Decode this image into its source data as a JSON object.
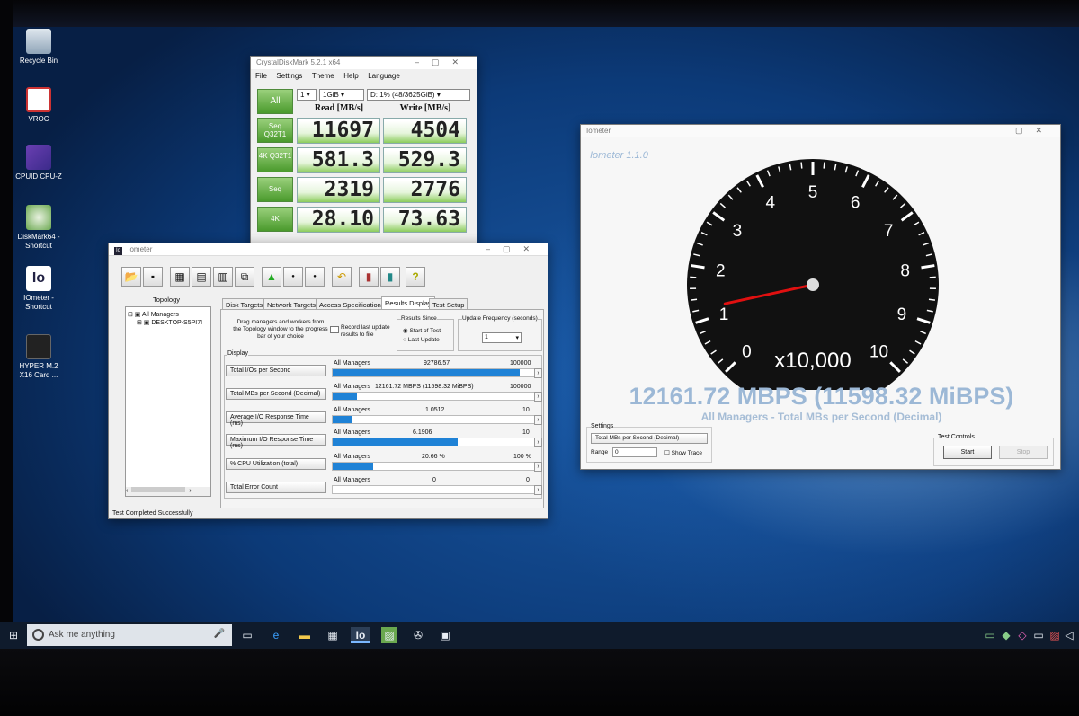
{
  "desktop": {
    "icons": [
      {
        "label": "Recycle Bin"
      },
      {
        "label": "VROC"
      },
      {
        "label": "CPUID CPU-Z"
      },
      {
        "label": "DiskMark64 - Shortcut"
      },
      {
        "label": "IOmeter - Shortcut"
      },
      {
        "label": "HYPER M.2 X16 Card ..."
      }
    ]
  },
  "cdm": {
    "title": "CrystalDiskMark 5.2.1 x64",
    "menu": [
      "File",
      "Settings",
      "Theme",
      "Help",
      "Language"
    ],
    "all_label": "All",
    "count": "1",
    "size": "1GiB",
    "drive": "D: 1% (48/3625GiB)",
    "read_header": "Read [MB/s]",
    "write_header": "Write [MB/s]",
    "rows": [
      {
        "label": "Seq Q32T1",
        "read": "11697",
        "write": "4504"
      },
      {
        "label": "4K Q32T1",
        "read": "581.3",
        "write": "529.3"
      },
      {
        "label": "Seq",
        "read": "2319",
        "write": "2776"
      },
      {
        "label": "4K",
        "read": "28.10",
        "write": "73.63"
      }
    ]
  },
  "iometer": {
    "title": "Iometer",
    "topology_header": "Topology",
    "tree": [
      "All Managers",
      "DESKTOP-S5PI7I"
    ],
    "tabs": [
      "Disk Targets",
      "Network Targets",
      "Access Specifications",
      "Results Display",
      "Test Setup"
    ],
    "instructions": "Drag managers and workers from the Topology window to the progress bar of your choice",
    "record_label": "Record last update results to file",
    "results_since_title": "Results Since",
    "results_since": [
      "Start of Test",
      "Last Update"
    ],
    "update_freq_title": "Update Frequency (seconds)",
    "update_freq_value": "1",
    "display_title": "Display",
    "rows": [
      {
        "label": "Total I/Os per Second",
        "manager": "All Managers",
        "value": "92786.57",
        "max": "100000",
        "fraction": 0.93
      },
      {
        "label": "Total MBs per Second (Decimal)",
        "manager": "All Managers",
        "value": "12161.72 MBPS (11598.32 MiBPS)",
        "max": "100000",
        "fraction": 0.12
      },
      {
        "label": "Average I/O Response Time (ms)",
        "manager": "All Managers",
        "value": "1.0512",
        "max": "10",
        "fraction": 0.1
      },
      {
        "label": "Maximum I/O Response Time (ms)",
        "manager": "All Managers",
        "value": "6.1906",
        "max": "10",
        "fraction": 0.62
      },
      {
        "label": "% CPU Utilization (total)",
        "manager": "All Managers",
        "value": "20.66 %",
        "max": "100 %",
        "fraction": 0.2
      },
      {
        "label": "Total Error Count",
        "manager": "All Managers",
        "value": "0",
        "max": "0",
        "fraction": 0
      }
    ],
    "status": "Test Completed Successfully"
  },
  "gauge": {
    "title": "Iometer",
    "subtitle": "Iometer 1.1.0",
    "ticks": [
      "0",
      "1",
      "2",
      "3",
      "4",
      "5",
      "6",
      "7",
      "8",
      "9",
      "10"
    ],
    "multiplier": "x10,000",
    "needle_value": 1.216,
    "big_reading": "12161.72 MBPS (11598.32 MiBPS)",
    "caption": "All Managers - Total MBs per Second (Decimal)",
    "settings_title": "Settings",
    "settings_select": "Total MBs per Second (Decimal)",
    "range_label": "Range",
    "range_value": "0",
    "show_trace": "Show Trace",
    "test_controls_title": "Test Controls",
    "start_label": "Start",
    "stop_label": "Stop"
  },
  "taskbar": {
    "search_placeholder": "Ask me anything"
  }
}
